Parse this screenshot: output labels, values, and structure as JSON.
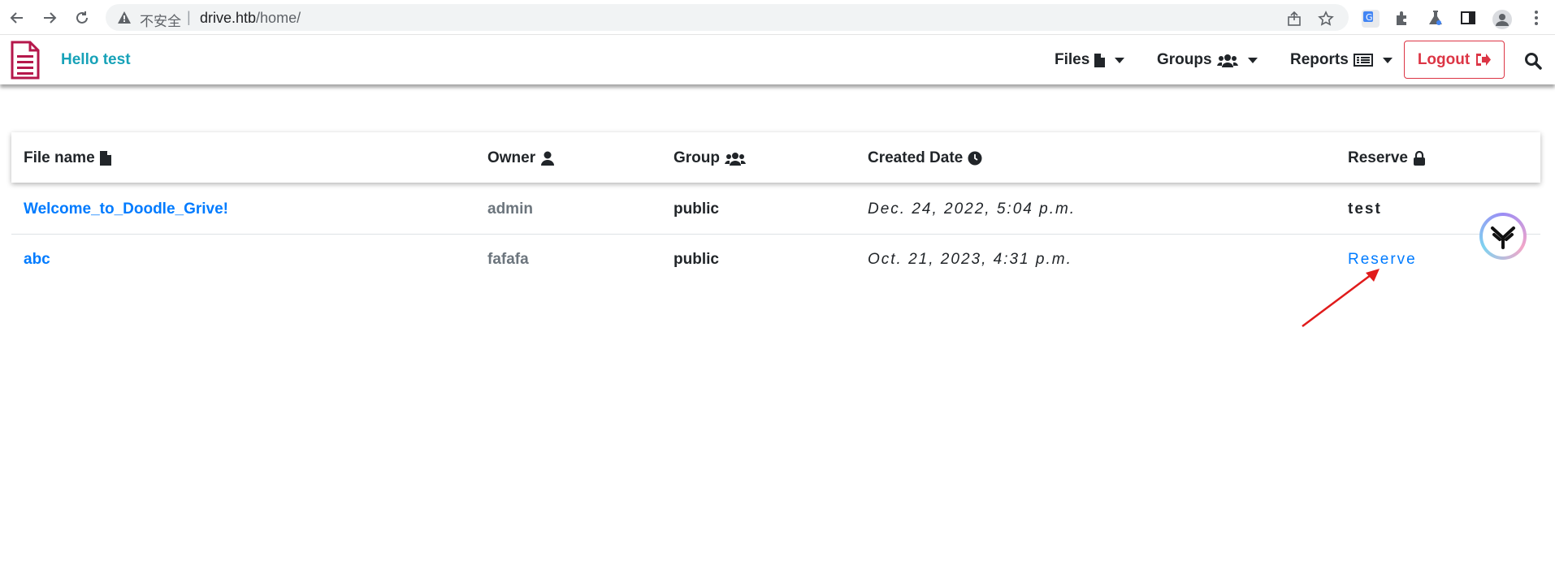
{
  "browser": {
    "security_label": "不安全",
    "separator": "|",
    "url_host": "drive.htb",
    "url_path": "/home/"
  },
  "navbar": {
    "greeting": "Hello test",
    "files_label": "Files",
    "groups_label": "Groups",
    "reports_label": "Reports",
    "logout_label": "Logout",
    "brand_color": "#b5174b",
    "accent_color": "#17a2b8"
  },
  "table": {
    "headers": {
      "file_name": "File name",
      "owner": "Owner",
      "group": "Group",
      "created_date": "Created Date",
      "reserve": "Reserve"
    },
    "rows": [
      {
        "file_name": "Welcome_to_Doodle_Grive!",
        "owner": "admin",
        "group": "public",
        "created_date": "Dec. 24, 2022, 5:04 p.m.",
        "reserve": "test"
      },
      {
        "file_name": "abc",
        "owner": "fafafa",
        "group": "public",
        "created_date": "Oct. 21, 2023, 4:31 p.m.",
        "reserve": "Reserve"
      }
    ]
  },
  "icons": {
    "file": "file-icon",
    "users": "users-icon",
    "report": "list-alt-icon",
    "logout": "sign-out-icon",
    "search": "search-icon",
    "owner": "user-icon",
    "date": "clock-icon",
    "lock": "lock-icon"
  }
}
